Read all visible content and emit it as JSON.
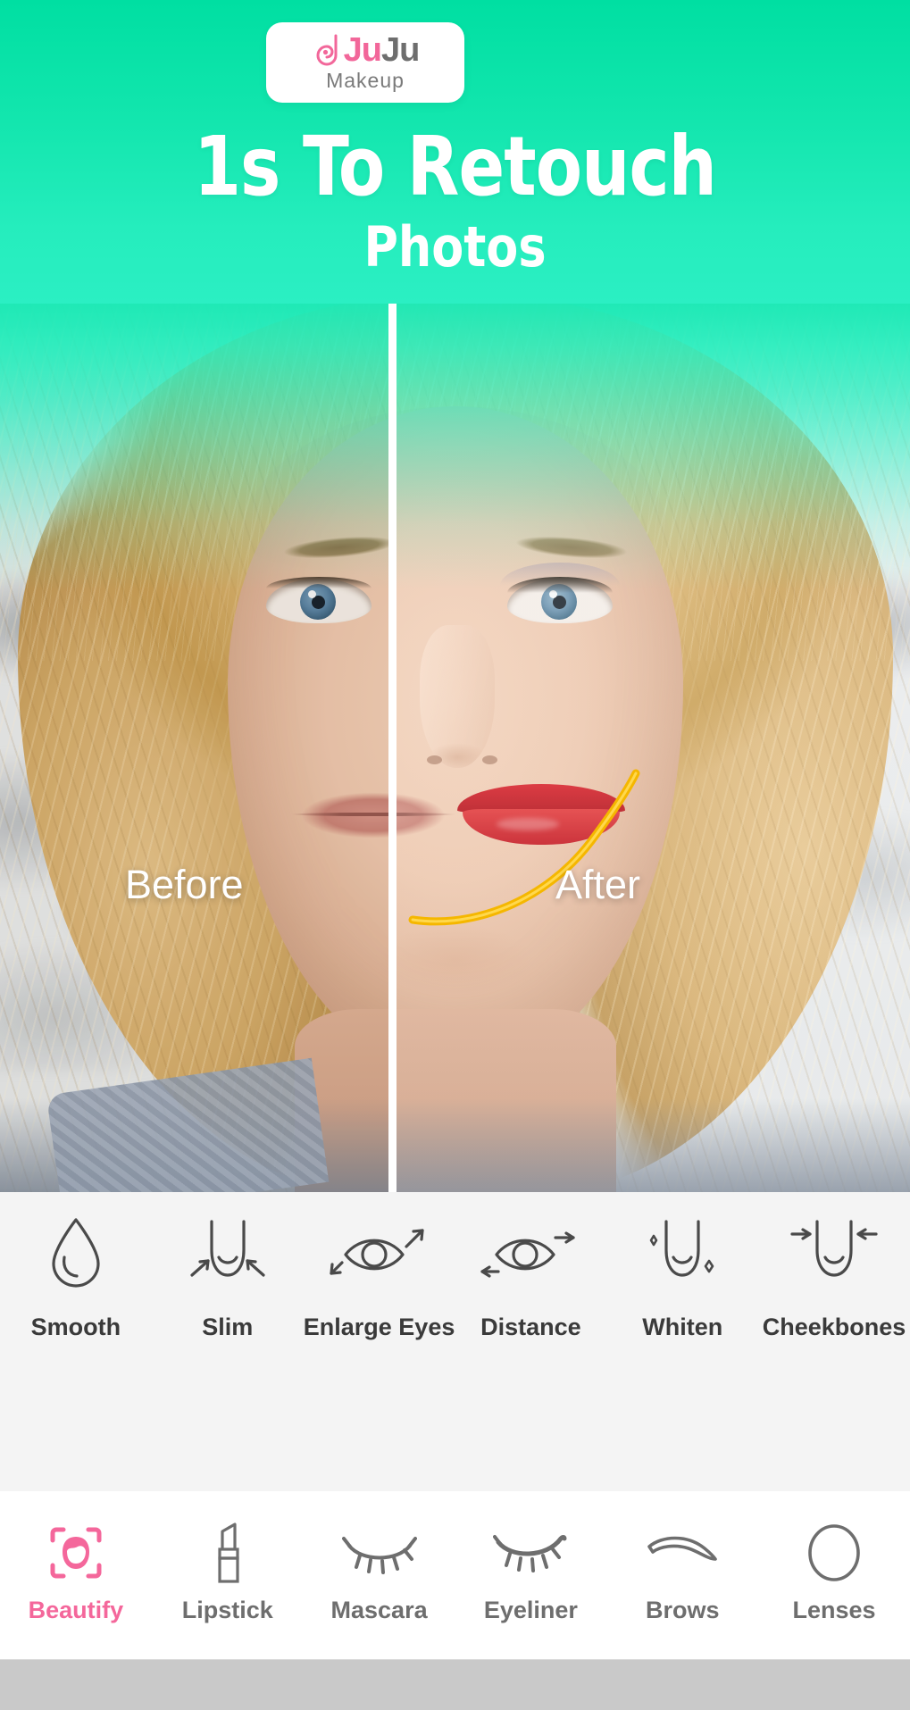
{
  "brand": {
    "logo_part1": "Ju",
    "logo_part2": "Ju",
    "logo_subtitle": "Makeup",
    "color_pink": "#F2679A",
    "color_gray": "#6E6E6E",
    "color_green": "#00DFA2"
  },
  "hero": {
    "headline": "1s To Retouch",
    "subline": "Photos",
    "before_label": "Before",
    "after_label": "After",
    "contour_color": "#F5B700",
    "lipstick_color": "#C41822"
  },
  "features": {
    "items": [
      {
        "label": "Smooth",
        "icon": "water-drop-icon"
      },
      {
        "label": "Slim",
        "icon": "face-slim-icon"
      },
      {
        "label": "Enlarge Eyes",
        "icon": "eye-enlarge-icon"
      },
      {
        "label": "Distance",
        "icon": "eye-distance-icon"
      },
      {
        "label": "Whiten",
        "icon": "face-whiten-icon"
      },
      {
        "label": "Cheekbones",
        "icon": "face-cheekbones-icon"
      }
    ]
  },
  "toolbar": {
    "active": "Beautify",
    "items": [
      {
        "label": "Beautify",
        "icon": "face-frame-icon",
        "active": true
      },
      {
        "label": "Lipstick",
        "icon": "lipstick-icon",
        "active": false
      },
      {
        "label": "Mascara",
        "icon": "lashes-icon",
        "active": false
      },
      {
        "label": "Eyeliner",
        "icon": "eyeliner-icon",
        "active": false
      },
      {
        "label": "Brows",
        "icon": "brow-icon",
        "active": false
      },
      {
        "label": "Lenses",
        "icon": "lens-circle-icon",
        "active": false
      }
    ]
  }
}
